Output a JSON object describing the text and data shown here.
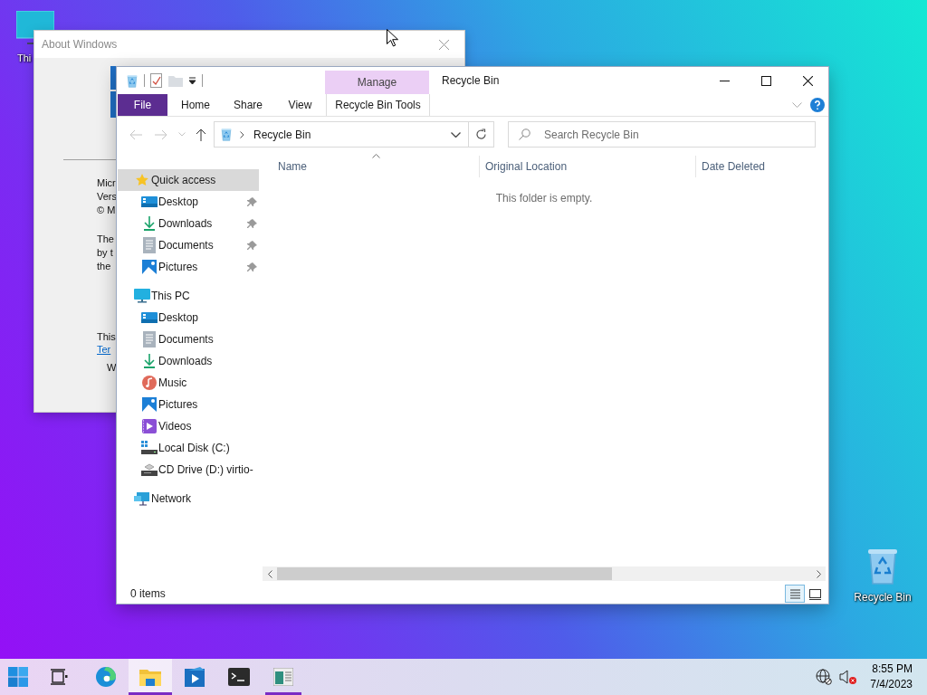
{
  "desktop_icons": [
    {
      "label": "Thi",
      "kind": "monitor"
    },
    {
      "label": "Recycle Bin",
      "kind": "recycle"
    }
  ],
  "about_window": {
    "title": "About Windows",
    "paragraphs": [
      [
        "Micr",
        "Vers",
        "© M"
      ],
      [
        "The",
        "by t",
        "the"
      ],
      [
        "This"
      ]
    ],
    "link": "Ter",
    "footer": "W"
  },
  "explorer": {
    "title": "Recycle Bin",
    "ribbon_group": "Manage",
    "ribbon_tabs": [
      {
        "label": "File",
        "kind": "file",
        "selected": false
      },
      {
        "label": "Home",
        "kind": "tab",
        "selected": false
      },
      {
        "label": "Share",
        "kind": "tab",
        "selected": false
      },
      {
        "label": "View",
        "kind": "tab",
        "selected": false
      },
      {
        "label": "Recycle Bin Tools",
        "kind": "contextual",
        "selected": false
      }
    ],
    "address": "Recycle Bin",
    "search": {
      "placeholder": "Search Recycle Bin"
    },
    "nav": [
      {
        "label": "Quick access",
        "kind": "star",
        "selected": true,
        "pinned": false,
        "children": [
          {
            "label": "Desktop",
            "kind": "desktop",
            "selected": false,
            "pinned": true
          },
          {
            "label": "Downloads",
            "kind": "downloads",
            "selected": false,
            "pinned": true
          },
          {
            "label": "Documents",
            "kind": "documents",
            "selected": false,
            "pinned": true
          },
          {
            "label": "Pictures",
            "kind": "pictures",
            "selected": false,
            "pinned": true
          }
        ]
      },
      {
        "label": "This PC",
        "kind": "monitor",
        "selected": false,
        "pinned": false,
        "children": [
          {
            "label": "Desktop",
            "kind": "desktop",
            "selected": false,
            "pinned": false
          },
          {
            "label": "Documents",
            "kind": "documents",
            "selected": false,
            "pinned": false
          },
          {
            "label": "Downloads",
            "kind": "downloads",
            "selected": false,
            "pinned": false
          },
          {
            "label": "Music",
            "kind": "music",
            "selected": false,
            "pinned": false
          },
          {
            "label": "Pictures",
            "kind": "pictures",
            "selected": false,
            "pinned": false
          },
          {
            "label": "Videos",
            "kind": "videos",
            "selected": false,
            "pinned": false
          },
          {
            "label": "Local Disk (C:)",
            "kind": "disk",
            "selected": false,
            "pinned": false
          },
          {
            "label": "CD Drive (D:) virtio-",
            "kind": "cd",
            "selected": false,
            "pinned": false
          }
        ]
      },
      {
        "label": "Network",
        "kind": "network",
        "selected": false,
        "pinned": false
      }
    ],
    "columns": [
      {
        "label": "Name",
        "sorted": true
      },
      {
        "label": "Original Location",
        "sorted": false
      },
      {
        "label": "Date Deleted",
        "sorted": false
      }
    ],
    "empty_message": "This folder is empty.",
    "status": "0 items",
    "views": [
      {
        "kind": "details",
        "selected": true
      },
      {
        "kind": "tiles",
        "selected": false
      }
    ]
  },
  "taskbar": {
    "apps": [
      {
        "kind": "start",
        "selected": false,
        "running": false
      },
      {
        "kind": "taskview",
        "selected": false,
        "running": false
      },
      {
        "kind": "edge",
        "selected": false,
        "running": false
      },
      {
        "kind": "explorer",
        "selected": true,
        "running": true
      },
      {
        "kind": "media",
        "selected": false,
        "running": false
      },
      {
        "kind": "terminal",
        "selected": false,
        "running": false
      },
      {
        "kind": "winver",
        "selected": false,
        "running": true
      }
    ],
    "clock": {
      "time": "8:55 PM",
      "date": "7/4/2023"
    }
  }
}
